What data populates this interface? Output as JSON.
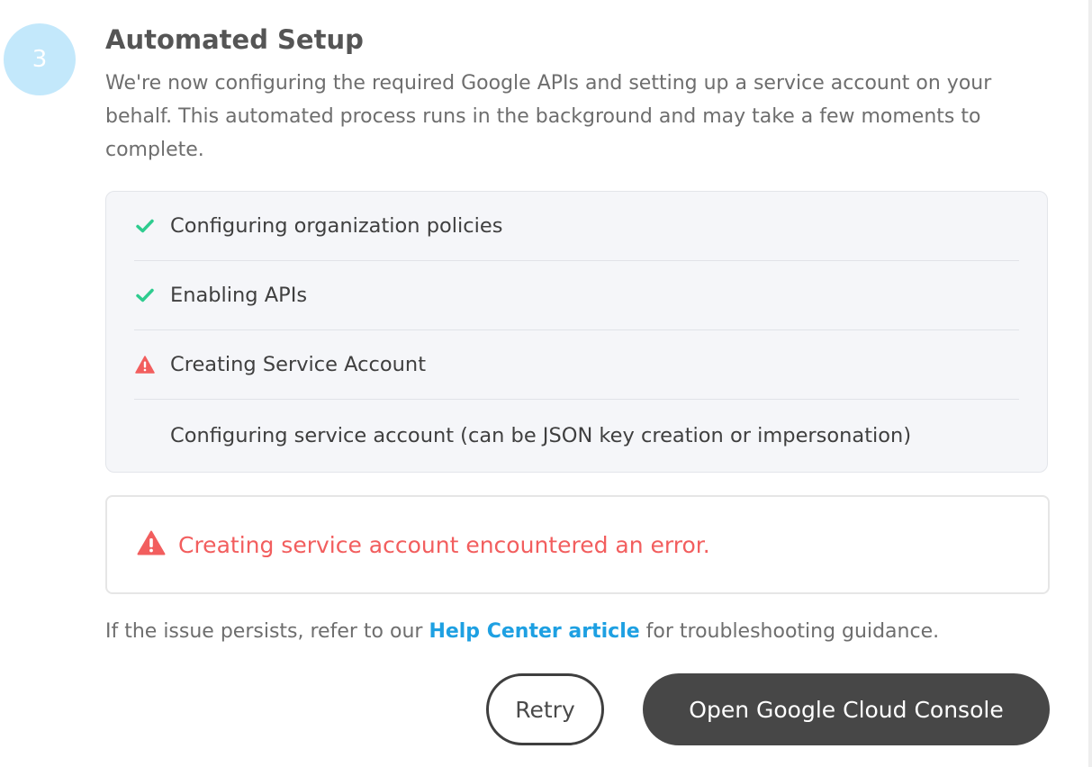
{
  "step": {
    "number": "3",
    "title": "Automated Setup",
    "description": "We're now configuring the required Google APIs and setting up a service account on your behalf. This automated process runs in the background and may take a few moments to complete."
  },
  "progress": {
    "items": [
      {
        "label": "Configuring organization policies",
        "status": "done",
        "icon": "check-icon"
      },
      {
        "label": "Enabling APIs",
        "status": "done",
        "icon": "check-icon"
      },
      {
        "label": "Creating Service Account",
        "status": "error",
        "icon": "warning-icon"
      },
      {
        "label": "Configuring service account (can be JSON key creation or impersonation)",
        "status": "pending",
        "icon": ""
      }
    ]
  },
  "error": {
    "message": "Creating service account encountered an error.",
    "icon": "warning-icon"
  },
  "help": {
    "prefix": "If the issue persists, refer to our ",
    "link_label": "Help Center article",
    "suffix": " for troubleshooting guidance."
  },
  "actions": {
    "retry_label": "Retry",
    "console_label": "Open Google Cloud Console"
  },
  "colors": {
    "success": "#2ecc8f",
    "error": "#f25e5e",
    "link": "#1ea0e2",
    "step_circle": "#c3e8fb",
    "primary_button": "#474747"
  }
}
